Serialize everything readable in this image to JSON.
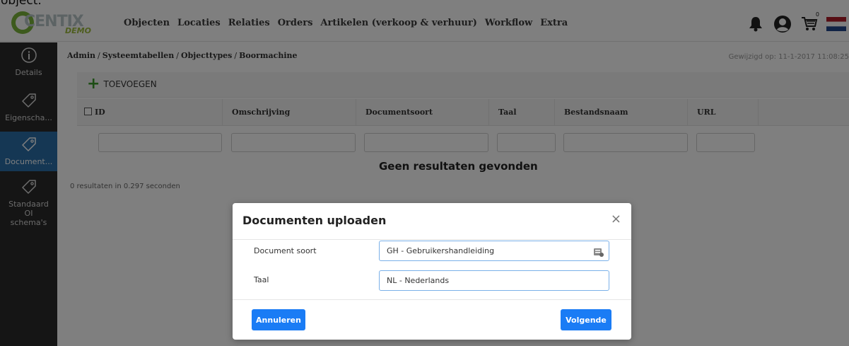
{
  "page_title": "object.",
  "app": {
    "logo_text": "CENTIX",
    "logo_subtext": "DEMO"
  },
  "menu": {
    "items": [
      {
        "label": "Objecten"
      },
      {
        "label": "Locaties"
      },
      {
        "label": "Relaties"
      },
      {
        "label": "Orders"
      },
      {
        "label": "Artikelen (verkoop & verhuur)"
      },
      {
        "label": "Workflow"
      },
      {
        "label": "Extra"
      }
    ]
  },
  "nav_icons": {
    "cart_badge": "0"
  },
  "sidebar": {
    "items": [
      {
        "label": "Details",
        "icon": "info-icon"
      },
      {
        "label": "Eigenscha...",
        "icon": "tag-icon"
      },
      {
        "label": "Document...",
        "icon": "tag-icon",
        "active": true
      },
      {
        "label_lines": [
          "Standaard",
          "OI",
          "schema's"
        ],
        "icon": "tag-icon"
      }
    ]
  },
  "breadcrumb": {
    "items": [
      "Admin",
      "Systeemtabellen",
      "Objecttypes",
      "Boormachine"
    ],
    "separator": "/"
  },
  "modified": "Gewijzigd op: 11-1-2017 11:08:25",
  "toolbar": {
    "add_label": "TOEVOEGEN"
  },
  "table": {
    "columns": [
      "ID",
      "Omschrijving",
      "Documentsoort",
      "Taal",
      "Bestandsnaam",
      "URL"
    ],
    "empty_message": "Geen resultaten gevonden",
    "result_count": "0 resultaten in 0.297 seconden"
  },
  "modal": {
    "title": "Documenten uploaden",
    "close": "×",
    "fields": [
      {
        "label": "Document soort",
        "value": "GH - Gebruikershandleiding"
      },
      {
        "label": "Taal",
        "value": "NL - Nederlands"
      }
    ],
    "cancel_label": "Annuleren",
    "next_label": "Volgende"
  },
  "colors": {
    "primary_button": "#1a7cf5",
    "sidebar_bg": "#2b2b2b",
    "sidebar_active": "#2a6ea8",
    "add_icon": "#3a9a2b",
    "logo_green": "#7ab43a"
  }
}
